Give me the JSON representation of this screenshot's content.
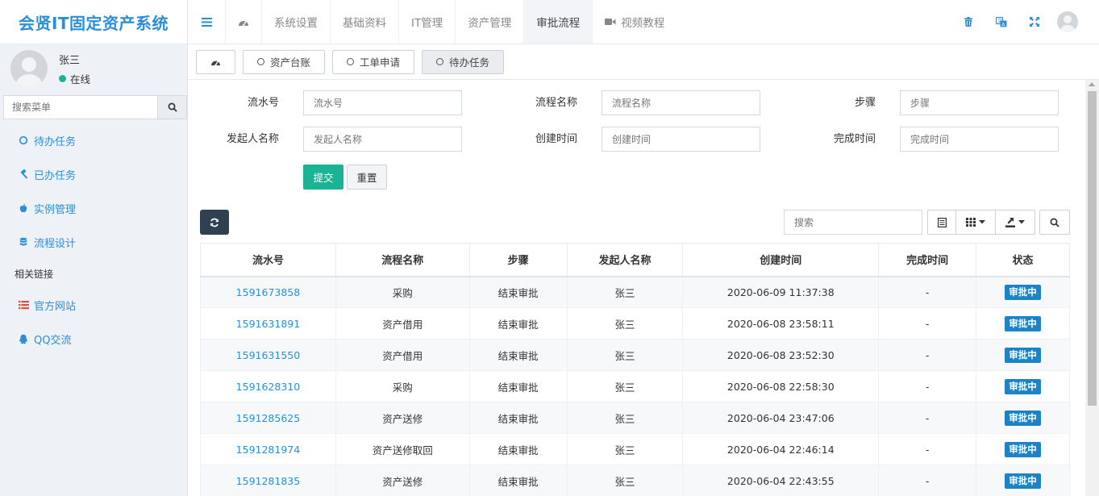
{
  "app": {
    "title": "会贤IT固定资产系统"
  },
  "user": {
    "name": "张三",
    "status": "在线"
  },
  "sidebar": {
    "search_placeholder": "搜索菜单",
    "items": [
      {
        "label": "待办任务",
        "icon": "circle-outline-icon"
      },
      {
        "label": "已办任务",
        "icon": "gavel-icon"
      },
      {
        "label": "实例管理",
        "icon": "apple-icon"
      },
      {
        "label": "流程设计",
        "icon": "database-icon"
      }
    ],
    "section_label": "相关链接",
    "links": [
      {
        "label": "官方网站",
        "icon": "list-icon",
        "color": "#e74c3c"
      },
      {
        "label": "QQ交流",
        "icon": "qq-icon"
      }
    ]
  },
  "header": {
    "nav": [
      {
        "label": "系统设置"
      },
      {
        "label": "基础资料"
      },
      {
        "label": "IT管理"
      },
      {
        "label": "资产管理"
      },
      {
        "label": "审批流程",
        "active": true
      },
      {
        "label": "视频教程"
      }
    ]
  },
  "subtabs": [
    {
      "label": "资产台账"
    },
    {
      "label": "工单申请"
    },
    {
      "label": "待办任务",
      "active": true
    }
  ],
  "form": {
    "fields": [
      {
        "label": "流水号",
        "placeholder": "流水号"
      },
      {
        "label": "流程名称",
        "placeholder": "流程名称"
      },
      {
        "label": "步骤",
        "placeholder": "步骤"
      },
      {
        "label": "发起人名称",
        "placeholder": "发起人名称"
      },
      {
        "label": "创建时间",
        "placeholder": "创建时间"
      },
      {
        "label": "完成时间",
        "placeholder": "完成时间"
      }
    ],
    "submit_label": "提交",
    "reset_label": "重置"
  },
  "toolbar": {
    "search_placeholder": "搜索"
  },
  "table": {
    "columns": [
      "流水号",
      "流程名称",
      "步骤",
      "发起人名称",
      "创建时间",
      "完成时间",
      "状态"
    ],
    "rows": [
      {
        "serial": "1591673858",
        "name": "采购",
        "step": "结束审批",
        "initiator": "张三",
        "created": "2020-06-09 11:37:38",
        "finished": "-",
        "status": "审批中"
      },
      {
        "serial": "1591631891",
        "name": "资产借用",
        "step": "结束审批",
        "initiator": "张三",
        "created": "2020-06-08 23:58:11",
        "finished": "-",
        "status": "审批中"
      },
      {
        "serial": "1591631550",
        "name": "资产借用",
        "step": "结束审批",
        "initiator": "张三",
        "created": "2020-06-08 23:52:30",
        "finished": "-",
        "status": "审批中"
      },
      {
        "serial": "1591628310",
        "name": "采购",
        "step": "结束审批",
        "initiator": "张三",
        "created": "2020-06-08 22:58:30",
        "finished": "-",
        "status": "审批中"
      },
      {
        "serial": "1591285625",
        "name": "资产送修",
        "step": "结束审批",
        "initiator": "张三",
        "created": "2020-06-04 23:47:06",
        "finished": "-",
        "status": "审批中"
      },
      {
        "serial": "1591281974",
        "name": "资产送修取回",
        "step": "结束审批",
        "initiator": "张三",
        "created": "2020-06-04 22:46:14",
        "finished": "-",
        "status": "审批中"
      },
      {
        "serial": "1591281835",
        "name": "资产送修",
        "step": "结束审批",
        "initiator": "张三",
        "created": "2020-06-04 22:43:55",
        "finished": "-",
        "status": "审批中"
      }
    ]
  },
  "colors": {
    "accent": "#2a8fd6",
    "success": "#1ab394",
    "badge": "#1c84c6",
    "dark": "#2f4050"
  }
}
